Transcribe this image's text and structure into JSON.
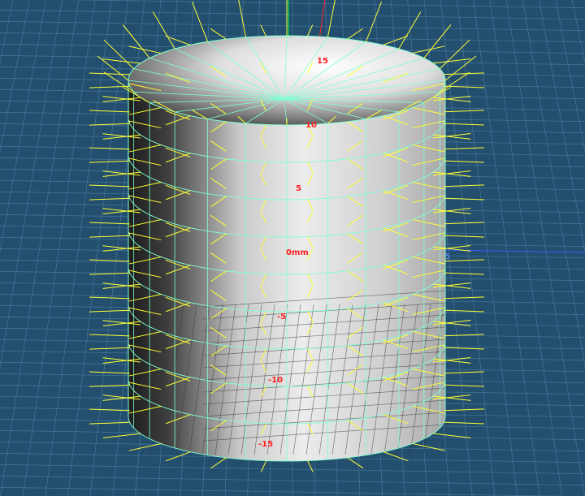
{
  "viewport": {
    "background": "#234e6e",
    "grid_color": "#4a7ea3",
    "wireframe_color": "#7fffd4",
    "normal_color": "#ffff33",
    "axis_x_color": "#3a5bff",
    "axis_y_color": "#00ff44",
    "axis_z_color": "#ff2222",
    "label_color": "#ff2020"
  },
  "ruler": {
    "labels": [
      "15",
      "10",
      "5",
      "0mm",
      "-5",
      "-10",
      "-15"
    ]
  },
  "axis_end_label": "5"
}
